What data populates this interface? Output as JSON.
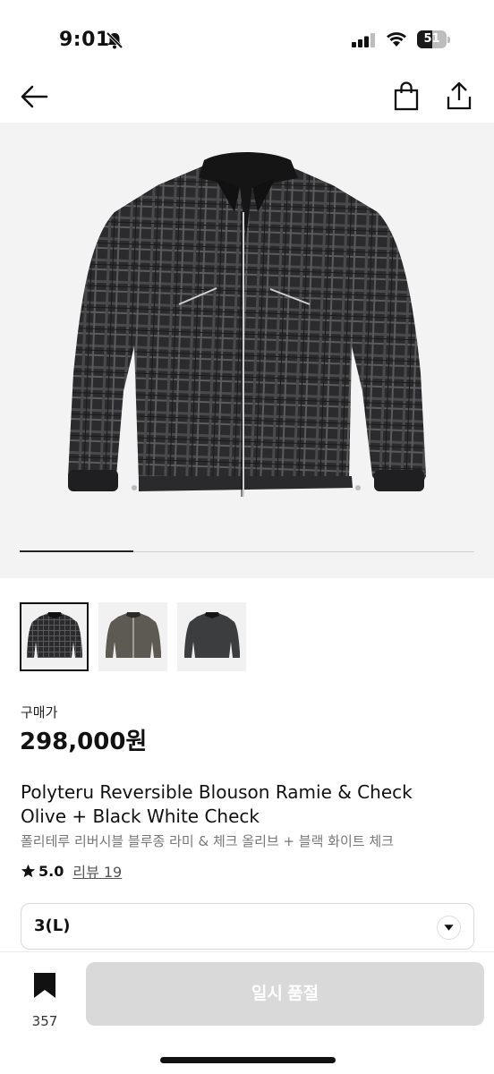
{
  "status_bar": {
    "time": "9:01",
    "battery": "51",
    "battery_level": 0.51
  },
  "nav": {
    "back_icon": "arrow-left-icon",
    "cart_icon": "shopping-bag-icon",
    "share_icon": "share-icon"
  },
  "gallery": {
    "progress": 0.25,
    "thumbnail_count": 3,
    "selected_index": 0
  },
  "product": {
    "price_label": "구매가",
    "price": "298,000원",
    "title_line1": "Polyteru Reversible Blouson Ramie & Check",
    "title_line2": "Olive + Black White Check",
    "title_ko": "폴리테루 리버시블 블루종 라미 & 체크 올리브 + 블랙 화이트 체크",
    "rating": "5.0",
    "review_label": "리뷰 19"
  },
  "options": {
    "size_selected": "3(L)"
  },
  "bottom": {
    "bookmark_count": "357",
    "button_label": "일시 품절"
  },
  "colors": {
    "accent": "#111111",
    "disabled_button": "#d9d9d9",
    "image_bg": "#f3f3f3"
  }
}
